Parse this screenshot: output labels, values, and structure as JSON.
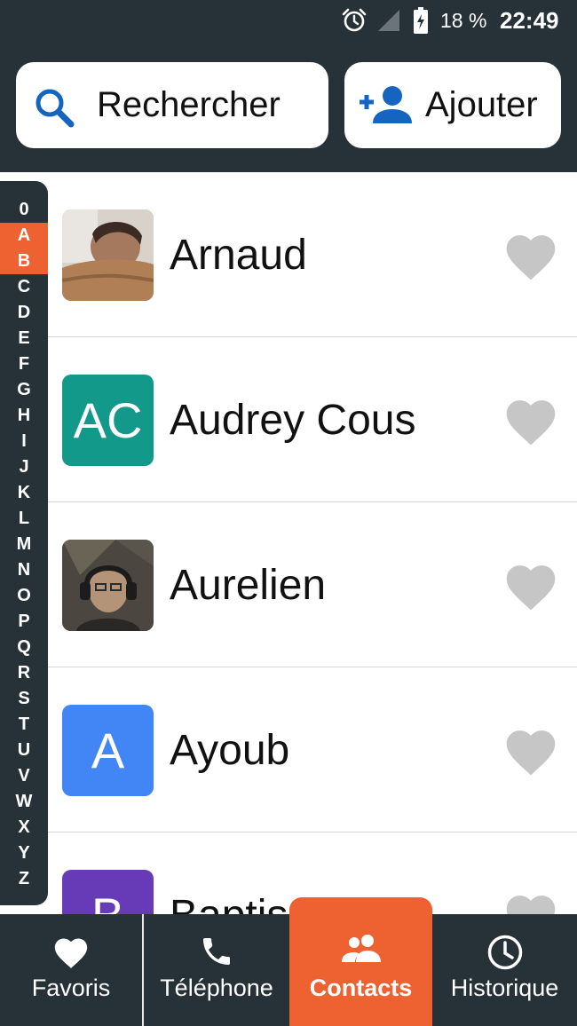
{
  "status_bar": {
    "battery_percent": "18 %",
    "time": "22:49",
    "icons": [
      "alarm-icon",
      "signal-icon",
      "battery-charging-icon"
    ]
  },
  "toolbar": {
    "search_label": "Rechercher",
    "add_label": "Ajouter"
  },
  "alphabet": [
    "0",
    "A",
    "B",
    "C",
    "D",
    "E",
    "F",
    "G",
    "H",
    "I",
    "J",
    "K",
    "L",
    "M",
    "N",
    "O",
    "P",
    "Q",
    "R",
    "S",
    "T",
    "U",
    "V",
    "W",
    "X",
    "Y",
    "Z"
  ],
  "alphabet_active": "A",
  "contacts": [
    {
      "name": "Arnaud",
      "avatar": "photo"
    },
    {
      "name": "Audrey Cous",
      "avatar": "AC",
      "avatar_color": "#12998a"
    },
    {
      "name": "Aurelien",
      "avatar": "photo"
    },
    {
      "name": "Ayoub",
      "avatar": "A",
      "avatar_color": "#4285f4"
    },
    {
      "name": "Baptis",
      "avatar": "B",
      "avatar_color": "#673ab7"
    }
  ],
  "nav": [
    {
      "label": "Favoris",
      "icon": "heart-icon"
    },
    {
      "label": "Téléphone",
      "icon": "phone-icon"
    },
    {
      "label": "Contacts",
      "icon": "people-icon",
      "active": true
    },
    {
      "label": "Historique",
      "icon": "clock-icon"
    }
  ],
  "colors": {
    "dark": "#263238",
    "accent": "#ee6130",
    "search_icon": "#1565c0",
    "heart_inactive": "#c6c6c6"
  }
}
